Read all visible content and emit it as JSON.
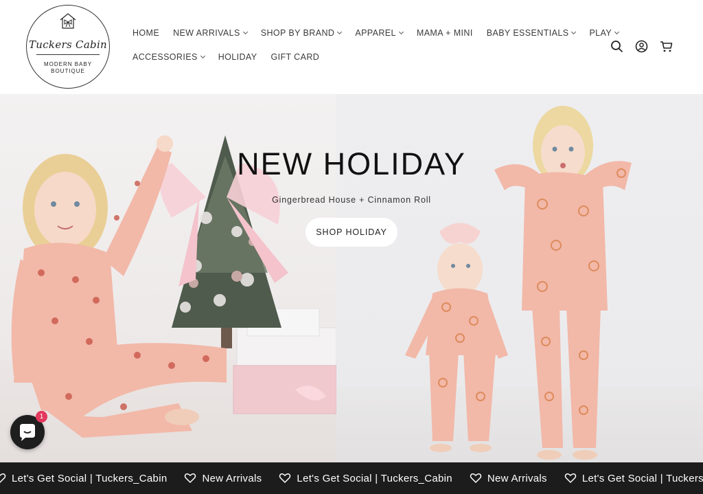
{
  "brand": {
    "script_name": "Tuckers Cabin",
    "tagline_line1": "MODERN BABY",
    "tagline_line2": "BOUTIQUE"
  },
  "nav": {
    "row1": [
      {
        "label": "HOME",
        "dropdown": false
      },
      {
        "label": "NEW ARRIVALS",
        "dropdown": true
      },
      {
        "label": "SHOP BY BRAND",
        "dropdown": true
      },
      {
        "label": "APPAREL",
        "dropdown": true
      },
      {
        "label": "MAMA + MINI",
        "dropdown": false
      },
      {
        "label": "BABY ESSENTIALS",
        "dropdown": true
      },
      {
        "label": "PLAY",
        "dropdown": true
      }
    ],
    "row2": [
      {
        "label": "ACCESSORIES",
        "dropdown": true
      },
      {
        "label": "HOLIDAY",
        "dropdown": false
      },
      {
        "label": "GIFT CARD",
        "dropdown": false
      }
    ]
  },
  "header_icons": [
    "search-icon",
    "account-icon",
    "cart-icon"
  ],
  "hero": {
    "title": "NEW HOLIDAY",
    "subtitle": "Gingerbread House + Cinnamon Roll",
    "button_label": "SHOP HOLIDAY"
  },
  "chat": {
    "badge_count": "1"
  },
  "marquee": {
    "items": [
      "Let's Get Social | Tuckers_Cabin",
      "New Arrivals",
      "Let's Get Social | Tuckers_Cabin",
      "New Arrivals",
      "Let's Get Social | Tuckers_Cabin"
    ]
  },
  "colors": {
    "marquee_bg": "#1c1c1c",
    "badge": "#e2385c",
    "pajama_pink": "#f2b8a8"
  }
}
